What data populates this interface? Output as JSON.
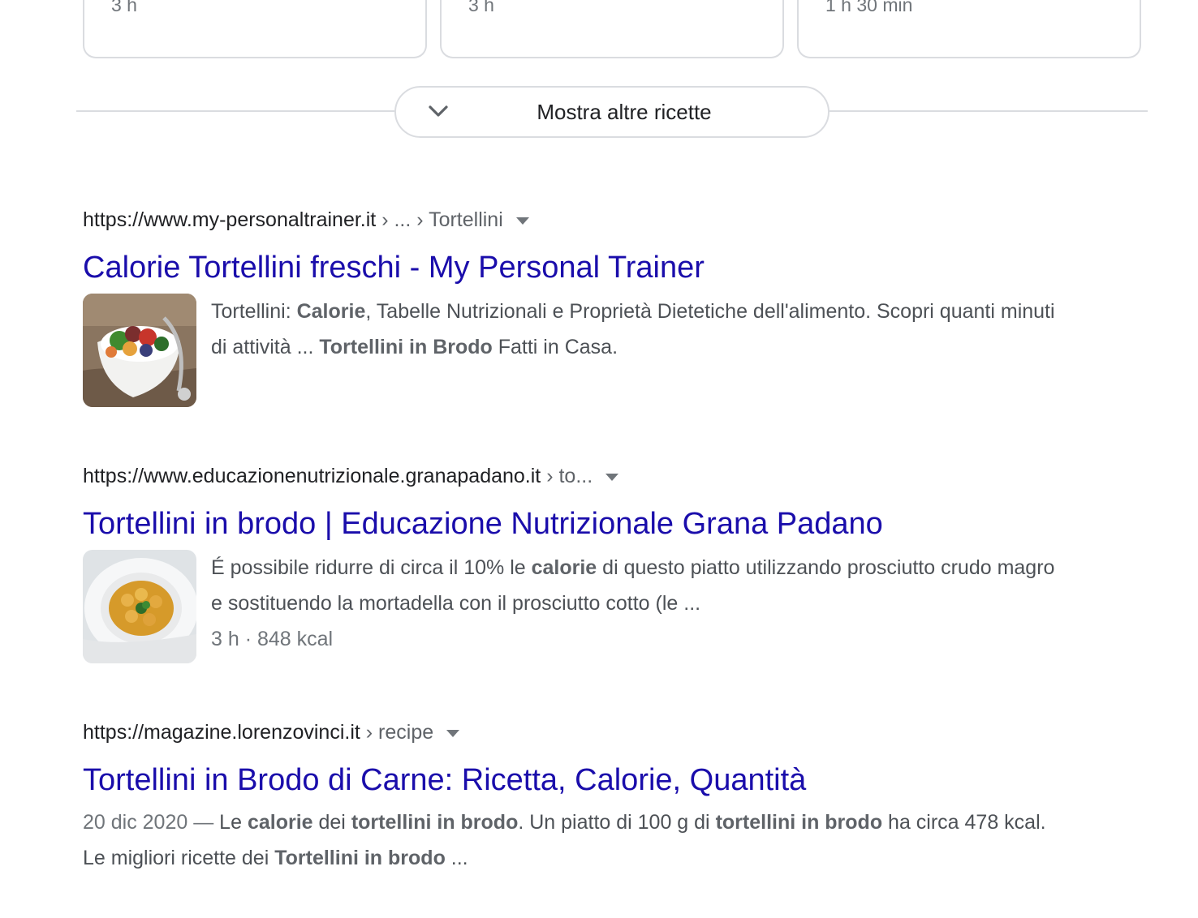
{
  "recipe_cards": [
    {
      "duration": "3 h"
    },
    {
      "duration": "3 h"
    },
    {
      "duration": "1 h 30 min"
    }
  ],
  "show_more": {
    "label": "Mostra altre ricette",
    "icon": "chevron-down-icon"
  },
  "results": [
    {
      "url": "https://www.my-personaltrainer.it",
      "breadcrumb": " › ... › Tortellini",
      "title": "Calorie Tortellini freschi - My Personal Trainer",
      "snippet": [
        {
          "t": "Tortellini: ",
          "b": false
        },
        {
          "t": "Calorie",
          "b": true
        },
        {
          "t": ", Tabelle Nutrizionali e Proprietà Dietetiche dell'alimento. Scopri quanti minuti di attività ... ",
          "b": false
        },
        {
          "t": "Tortellini in Brodo",
          "b": true
        },
        {
          "t": " Fatti in Casa.",
          "b": false
        }
      ]
    },
    {
      "url": "https://www.educazionenutrizionale.granapadano.it",
      "breadcrumb": " › to...",
      "title": "Tortellini in brodo | Educazione Nutrizionale Grana Padano",
      "snippet": [
        {
          "t": "É possibile ridurre di circa il 10% le ",
          "b": false
        },
        {
          "t": "calorie",
          "b": true
        },
        {
          "t": " di questo piatto utilizzando prosciutto crudo magro e sostituendo la mortadella con il prosciutto cotto (le ...",
          "b": false
        }
      ],
      "meta": "3 h · 848 kcal"
    },
    {
      "url": "https://magazine.lorenzovinci.it",
      "breadcrumb": " › recipe",
      "title": "Tortellini in Brodo di Carne: Ricetta, Calorie, Quantità",
      "date": "20 dic 2020 — ",
      "snippet": [
        {
          "t": "Le ",
          "b": false
        },
        {
          "t": "calorie",
          "b": true
        },
        {
          "t": " dei ",
          "b": false
        },
        {
          "t": "tortellini in brodo",
          "b": true
        },
        {
          "t": ". Un piatto di 100 g di ",
          "b": false
        },
        {
          "t": "tortellini in brodo",
          "b": true
        },
        {
          "t": " ha circa 478 kcal. Le migliori ricette dei ",
          "b": false
        },
        {
          "t": "Tortellini in brodo",
          "b": true
        },
        {
          "t": " ...",
          "b": false
        }
      ]
    }
  ]
}
